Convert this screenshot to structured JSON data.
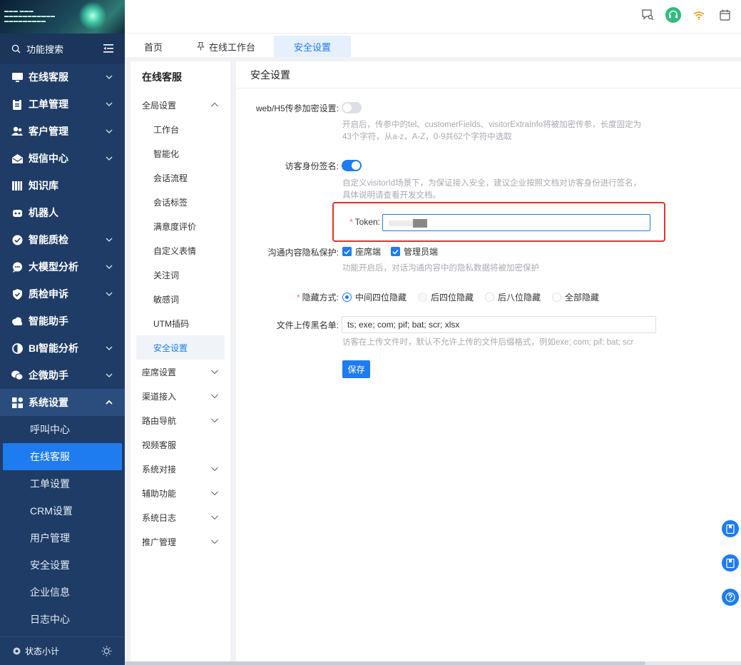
{
  "sidebar": {
    "search_label": "功能搜索",
    "menu": [
      {
        "label": "在线客服",
        "icon": "monitor-icon"
      },
      {
        "label": "工单管理",
        "icon": "clipboard-icon"
      },
      {
        "label": "客户管理",
        "icon": "users-icon"
      },
      {
        "label": "短信中心",
        "icon": "envelope-icon"
      },
      {
        "label": "知识库",
        "icon": "books-icon"
      },
      {
        "label": "机器人",
        "icon": "robot-icon"
      },
      {
        "label": "智能质检",
        "icon": "check-circle-icon"
      },
      {
        "label": "大模型分析",
        "icon": "chat-icon"
      },
      {
        "label": "质检申诉",
        "icon": "shield-icon"
      },
      {
        "label": "智能助手",
        "icon": "cloud-icon"
      },
      {
        "label": "BI智能分析",
        "icon": "pie-icon"
      },
      {
        "label": "企微助手",
        "icon": "wechat-icon"
      },
      {
        "label": "系统设置",
        "icon": "grid-icon"
      }
    ],
    "submenu": [
      "呼叫中心",
      "在线客服",
      "工单设置",
      "CRM设置",
      "用户管理",
      "安全设置",
      "企业信息",
      "日志中心"
    ],
    "footer_label": "状态小计"
  },
  "tabs": [
    {
      "label": "首页"
    },
    {
      "label": "在线工作台"
    },
    {
      "label": "安全设置"
    }
  ],
  "subnav": {
    "title": "在线客服",
    "group_global": "全局设置",
    "children": [
      "工作台",
      "智能化",
      "会话流程",
      "会话标签",
      "满意度评价",
      "自定义表情",
      "关注词",
      "敏感词",
      "UTM插码",
      "安全设置"
    ],
    "groups_after": [
      {
        "label": "座席设置",
        "chevron": true
      },
      {
        "label": "渠道接入",
        "chevron": true
      },
      {
        "label": "路由导航",
        "chevron": true
      },
      {
        "label": "视频客服",
        "chevron": false
      },
      {
        "label": "系统对接",
        "chevron": true
      },
      {
        "label": "辅助功能",
        "chevron": true
      },
      {
        "label": "系统日志",
        "chevron": true
      },
      {
        "label": "推广管理",
        "chevron": true
      }
    ]
  },
  "main": {
    "title": "安全设置",
    "h5_label": "web/H5传参加密设置:",
    "h5_hint_1": "开启后，传参中的tel、customerFields、visitorExtraInfo将被加密传参，长度固定为",
    "h5_hint_2": "43个字符，从a-z，A-Z，0-9共62个字符中选取",
    "sign_label": "访客身份签名:",
    "sign_hint_1": "自定义visitorId场景下，为保证接入安全，建议企业按照文档对访客身份进行签名，",
    "sign_hint_2": "具体说明请查看开发文档。",
    "token_label": "Token:",
    "token_value": "",
    "privacy_label": "沟通内容隐私保护:",
    "privacy_options": [
      "座席端",
      "管理员端"
    ],
    "privacy_hint": "功能开启后，对话沟通内容中的隐私数据将被加密保护",
    "hide_label": "隐藏方式:",
    "hide_options": [
      "中间四位隐藏",
      "后四位隐藏",
      "后八位隐藏",
      "全部隐藏"
    ],
    "blacklist_label": "文件上传黑名单:",
    "blacklist_value": "ts; exe; com; pif; bat; scr; xlsx",
    "blacklist_hint": "访客在上传文件时，默认不允许上传的文件后缀格式，例如exe; com; pif; bat; scr",
    "save_label": "保存"
  },
  "colors": {
    "sidebar_bg": "#1f3c66",
    "primary": "#1e7cf0",
    "highlight_box": "#e5312f"
  }
}
